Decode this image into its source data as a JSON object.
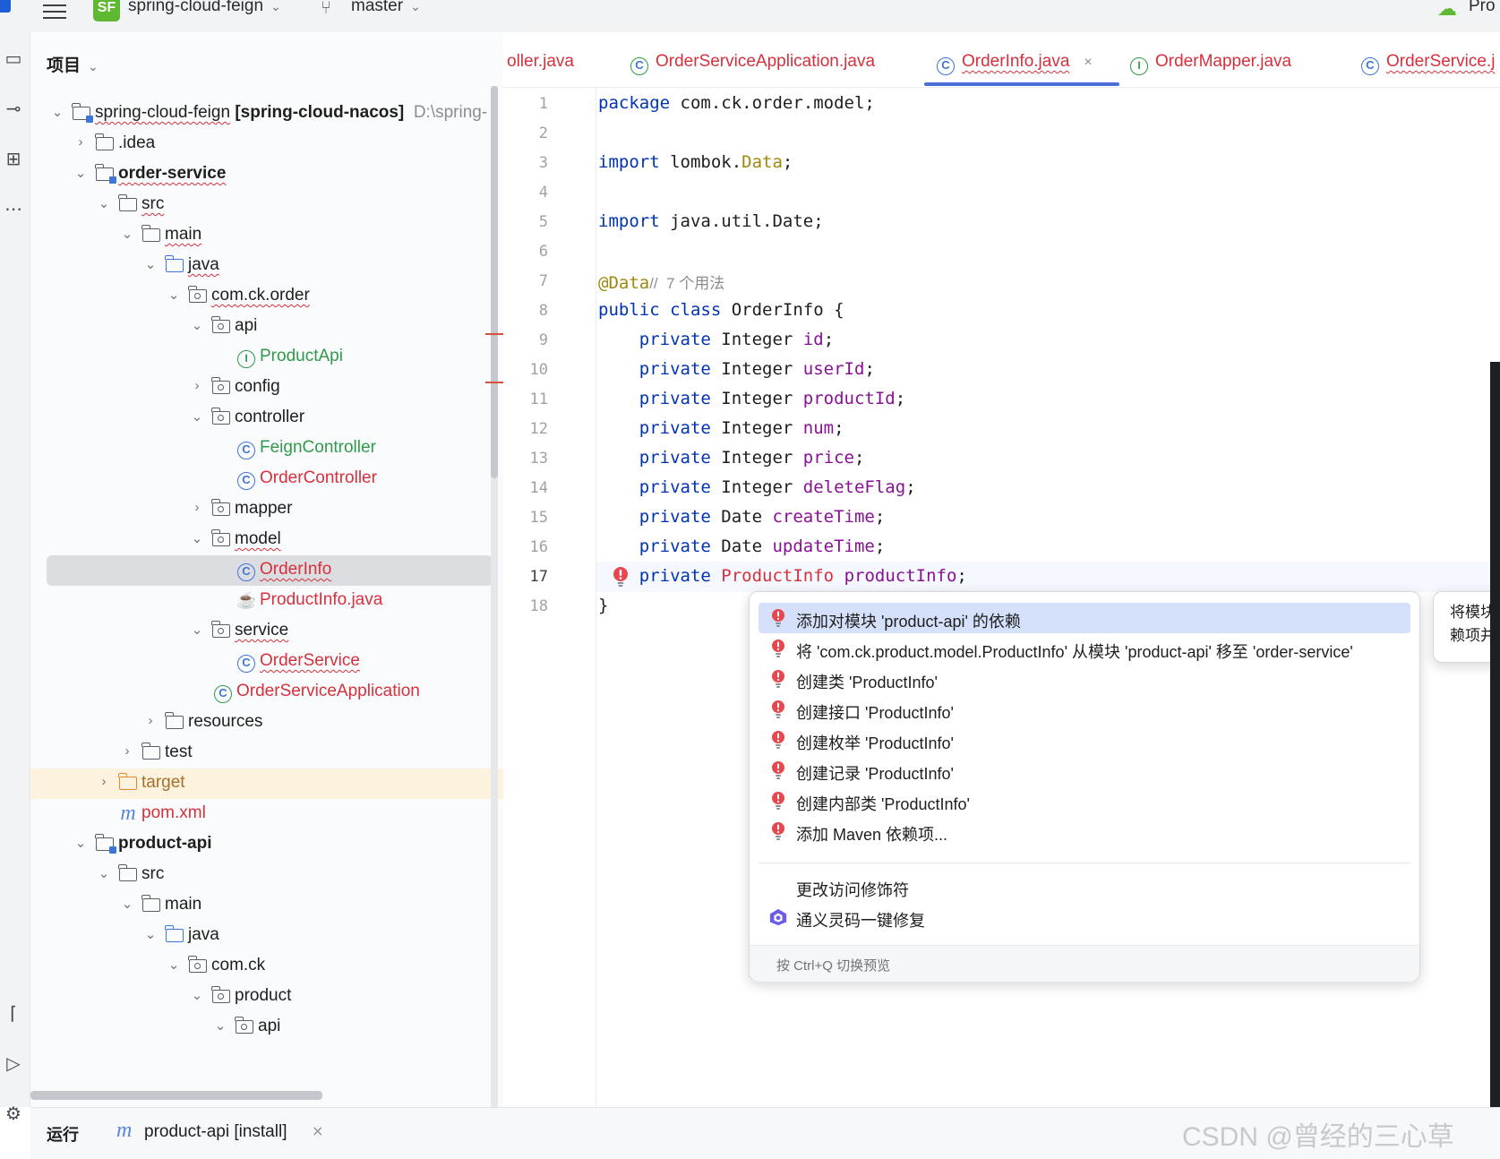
{
  "topbar": {
    "project_badge": "SF",
    "project_name": "spring-cloud-feign",
    "branch": "master",
    "run_config": "Pro"
  },
  "project_panel": {
    "title": "项目",
    "tree": [
      {
        "label": "spring-cloud-feign",
        "suffix": "[spring-cloud-nacos]",
        "path": "D:\\spring-"
      },
      {
        "label": ".idea"
      },
      {
        "label": "order-service"
      },
      {
        "label": "src"
      },
      {
        "label": "main"
      },
      {
        "label": "java"
      },
      {
        "label": "com.ck.order"
      },
      {
        "label": "api"
      },
      {
        "label": "ProductApi"
      },
      {
        "label": "config"
      },
      {
        "label": "controller"
      },
      {
        "label": "FeignController"
      },
      {
        "label": "OrderController"
      },
      {
        "label": "mapper"
      },
      {
        "label": "model"
      },
      {
        "label": "OrderInfo"
      },
      {
        "label": "ProductInfo.java"
      },
      {
        "label": "service"
      },
      {
        "label": "OrderService"
      },
      {
        "label": "OrderServiceApplication"
      },
      {
        "label": "resources"
      },
      {
        "label": "test"
      },
      {
        "label": "target"
      },
      {
        "label": "pom.xml"
      },
      {
        "label": "product-api"
      },
      {
        "label": "src"
      },
      {
        "label": "main"
      },
      {
        "label": "java"
      },
      {
        "label": "com.ck"
      },
      {
        "label": "product"
      },
      {
        "label": "api"
      }
    ]
  },
  "tabs": [
    {
      "label": "oller.java"
    },
    {
      "label": "OrderServiceApplication.java"
    },
    {
      "label": "OrderInfo.java",
      "active": true
    },
    {
      "label": "OrderMapper.java"
    },
    {
      "label": "OrderService.j"
    }
  ],
  "tab_close": "×",
  "editor": {
    "line_numbers": [
      "1",
      "2",
      "3",
      "4",
      "5",
      "6",
      "7",
      "8",
      "9",
      "10",
      "11",
      "12",
      "13",
      "14",
      "15",
      "16",
      "17",
      "18"
    ],
    "current_line": "17",
    "code": {
      "l1_kw": "package",
      "l1_rest": " com.ck.order.model;",
      "l3_kw": "import",
      "l3_a": " lombok.",
      "l3_ann": "Data",
      "l3_end": ";",
      "l5_kw": "import",
      "l5_rest": " java.util.Date;",
      "l7_ann": "@Data",
      "l7_cmt": "//  7 个用法",
      "l8_kw": "public class",
      "l8_rest": " OrderInfo {",
      "fields": [
        {
          "kw": "    private",
          "type": " Integer ",
          "name": "id",
          "end": ";"
        },
        {
          "kw": "    private",
          "type": " Integer ",
          "name": "userId",
          "end": ";"
        },
        {
          "kw": "    private",
          "type": " Integer ",
          "name": "productId",
          "end": ";"
        },
        {
          "kw": "    private",
          "type": " Integer ",
          "name": "num",
          "end": ";"
        },
        {
          "kw": "    private",
          "type": " Integer ",
          "name": "price",
          "end": ";"
        },
        {
          "kw": "    private",
          "type": " Integer ",
          "name": "deleteFlag",
          "end": ";"
        },
        {
          "kw": "    private",
          "type": " Date ",
          "name": "createTime",
          "end": ";"
        },
        {
          "kw": "    private",
          "type": " Date ",
          "name": "updateTime",
          "end": ";"
        }
      ],
      "l17_kw": "    private",
      "l17_type": " ProductInfo",
      "l17_name": " productInfo",
      "l17_end": ";",
      "l18": "}"
    }
  },
  "popup": {
    "items": [
      "添加对模块 'product-api' 的依赖",
      "将 'com.ck.product.model.ProductInfo' 从模块 'product-api' 移至 'order-service'",
      "创建类 'ProductInfo'",
      "创建接口 'ProductInfo'",
      "创建枚举 'ProductInfo'",
      "创建记录 'ProductInfo'",
      "创建内部类 'ProductInfo'",
      "添加 Maven 依赖项..."
    ],
    "extra_items": [
      "更改访问修饰符",
      "通义灵码一键修复"
    ],
    "footer": "按 Ctrl+Q 切换预览"
  },
  "preview": {
    "line1": "将模块",
    "line2": "赖项并"
  },
  "bottom": {
    "title": "运行",
    "tab": "product-api [install]",
    "close": "×"
  },
  "watermark": "CSDN @曾经的三心草",
  "colors": {
    "error": "#d6303d",
    "keyword": "#0033b3",
    "field": "#871094",
    "annotation": "#9e880d",
    "accent": "#4a6fd6"
  }
}
